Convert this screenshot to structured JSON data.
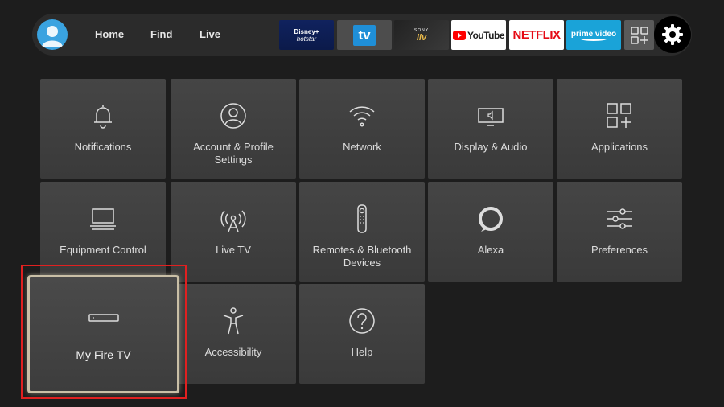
{
  "nav": {
    "links": [
      "Home",
      "Find",
      "Live"
    ],
    "apps": {
      "hotstar_line1": "Disney+",
      "hotstar_line2": "hotstar",
      "tv_label": "tv",
      "sonyliv_line1": "SONY",
      "sonyliv_line2": "liv",
      "youtube": "YouTube",
      "netflix": "NETFLIX",
      "prime": "prime video"
    }
  },
  "tiles": [
    {
      "label": "Notifications",
      "icon": "bell-icon"
    },
    {
      "label": "Account & Profile Settings",
      "icon": "profile-icon"
    },
    {
      "label": "Network",
      "icon": "wifi-icon"
    },
    {
      "label": "Display & Audio",
      "icon": "display-audio-icon"
    },
    {
      "label": "Applications",
      "icon": "applications-icon"
    },
    {
      "label": "Equipment Control",
      "icon": "tv-equipment-icon"
    },
    {
      "label": "Live TV",
      "icon": "antenna-icon"
    },
    {
      "label": "Remotes & Bluetooth Devices",
      "icon": "remote-icon"
    },
    {
      "label": "Alexa",
      "icon": "alexa-icon"
    },
    {
      "label": "Preferences",
      "icon": "sliders-icon"
    },
    {
      "label": "My Fire TV",
      "icon": "fire-tv-stick-icon"
    },
    {
      "label": "Accessibility",
      "icon": "accessibility-icon"
    },
    {
      "label": "Help",
      "icon": "help-icon"
    }
  ],
  "colors": {
    "background": "#1d1d1d",
    "tile": "#404040",
    "focus_border": "#c9bfa6",
    "highlight": "#e02020"
  }
}
